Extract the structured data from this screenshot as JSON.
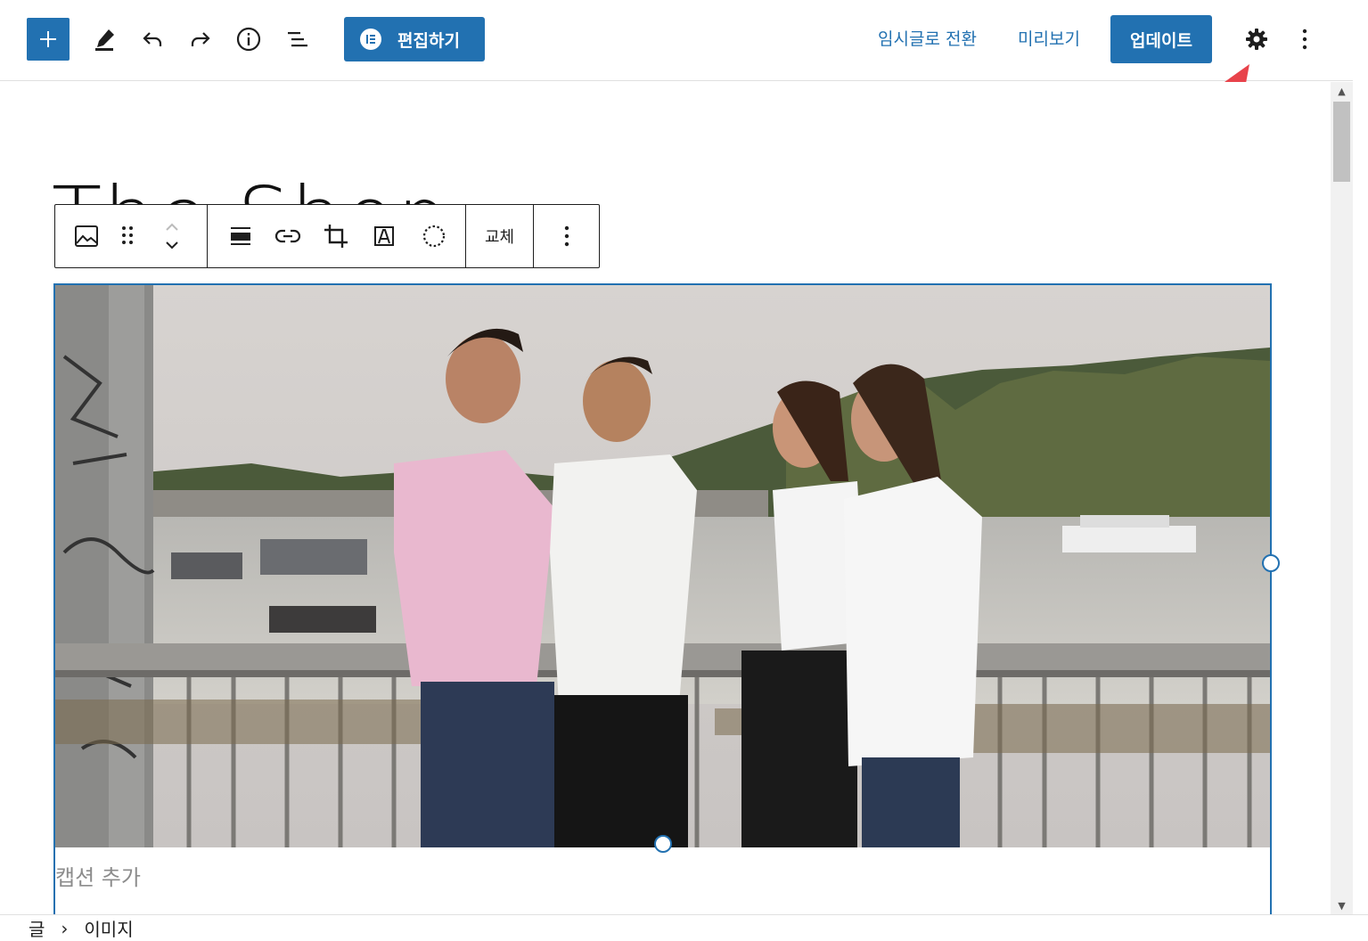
{
  "header": {
    "toolbar_icons": [
      "plus-icon",
      "pencil-icon",
      "undo-icon",
      "redo-icon",
      "info-icon",
      "list-view-icon"
    ],
    "elementor_label": "편집하기",
    "switch_to_draft_label": "임시글로 전환",
    "preview_label": "미리보기",
    "update_label": "업데이트",
    "settings_icon": "gear-icon",
    "more_icon": "kebab-icon"
  },
  "editor": {
    "post_title": "The Shop",
    "block_toolbar": {
      "groups": [
        [
          "image-icon",
          "drag-handle-icon",
          "move-up-down-icon"
        ],
        [
          "align-icon",
          "link-icon",
          "crop-icon",
          "text-overlay-icon",
          "circle-mask-icon"
        ],
        [
          "replace"
        ],
        [
          "kebab-icon"
        ]
      ],
      "replace_label": "교체"
    },
    "image": {
      "alt": "Four friends standing on a bridge with love locks over a river",
      "caption_placeholder": "캡션 추가"
    }
  },
  "breadcrumb": {
    "items": [
      "글",
      "이미지"
    ],
    "separator": "›"
  },
  "colors": {
    "accent": "#2271b1",
    "annotation_arrow": "#e8434b"
  }
}
